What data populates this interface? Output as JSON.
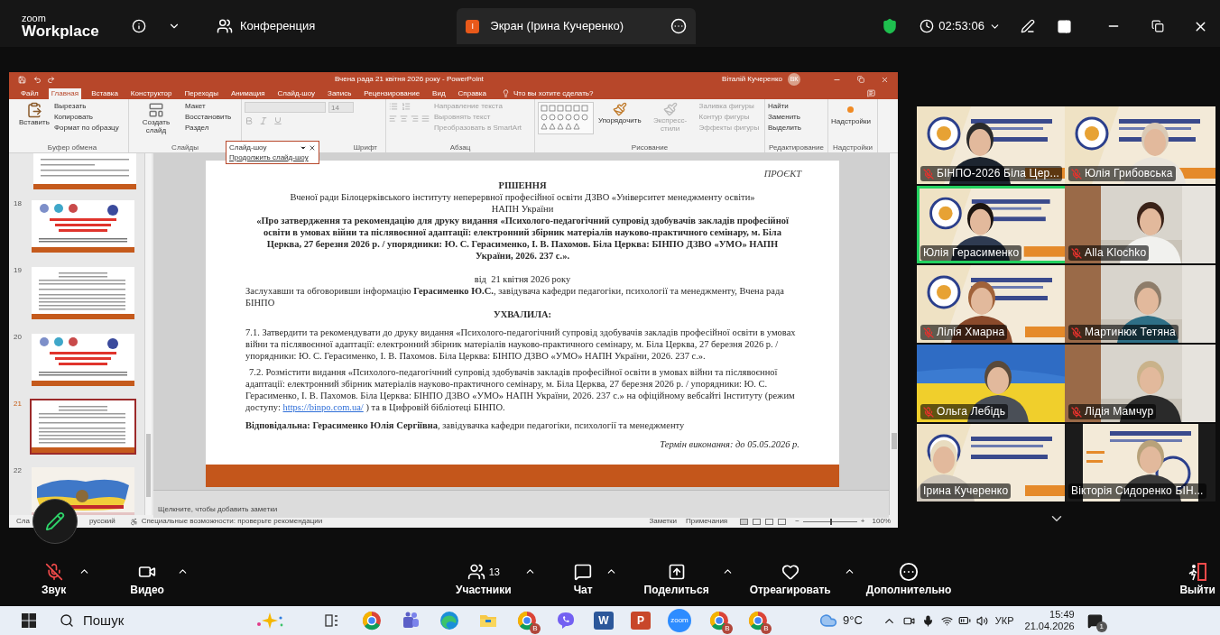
{
  "zoom_bar": {
    "logo_top": "zoom",
    "logo_bottom": "Workplace",
    "meeting_label": "Конференция",
    "share_tab": {
      "avatar": "І",
      "title": "Экран (Ірина Кучеренко)"
    },
    "timer": "02:53:06"
  },
  "powerpoint": {
    "title": "Вчена рада 21 квітня 2026 року - PowerPoint",
    "user": "Віталій Кучеренко",
    "user_initials": "ВК",
    "tabs": [
      {
        "label": "Файл",
        "selected": false
      },
      {
        "label": "Главная",
        "selected": true
      },
      {
        "label": "Вставка",
        "selected": false
      },
      {
        "label": "Конструктор",
        "selected": false
      },
      {
        "label": "Переходы",
        "selected": false
      },
      {
        "label": "Анимация",
        "selected": false
      },
      {
        "label": "Слайд-шоу",
        "selected": false
      },
      {
        "label": "Запись",
        "selected": false
      },
      {
        "label": "Рецензирование",
        "selected": false
      },
      {
        "label": "Вид",
        "selected": false
      },
      {
        "label": "Справка",
        "selected": false
      }
    ],
    "tell_me": "Что вы хотите сделать?",
    "ribbon": {
      "groups": [
        {
          "label": "Буфер обмена",
          "kind": "clipboard",
          "items": [
            {
              "label": "Вставить",
              "big": true
            },
            {
              "label": "Вырезать"
            },
            {
              "label": "Копировать"
            },
            {
              "label": "Формат по образцу"
            }
          ]
        },
        {
          "label": "Слайды",
          "kind": "slides",
          "items": [
            {
              "label": "Создать слайд",
              "big": true
            },
            {
              "label": "Макет"
            },
            {
              "label": "Восстановить"
            },
            {
              "label": "Раздел"
            }
          ]
        },
        {
          "label": "Шрифт",
          "kind": "font",
          "font_size": "14"
        },
        {
          "label": "Абзац",
          "kind": "paragraph",
          "items": [
            {
              "label": "Направление текста",
              "disabled": true
            },
            {
              "label": "Выровнять текст",
              "disabled": true
            },
            {
              "label": "Преобразовать в SmartArt",
              "disabled": true
            }
          ]
        },
        {
          "label": "Рисование",
          "kind": "drawing",
          "items": [
            {
              "label": "Упорядочить",
              "big": true
            },
            {
              "label": "Экспресс-стили",
              "big": true,
              "disabled": true
            },
            {
              "label": "Заливка фигуры",
              "disabled": true
            },
            {
              "label": "Контур фигуры",
              "disabled": true
            },
            {
              "label": "Эффекты фигуры",
              "disabled": true
            }
          ]
        },
        {
          "label": "Редактирование",
          "kind": "editing",
          "items": [
            {
              "label": "Найти"
            },
            {
              "label": "Заменить"
            },
            {
              "label": "Выделить"
            }
          ]
        },
        {
          "label": "Надстройки",
          "kind": "addins",
          "items": [
            {
              "label": "Надстройки",
              "big": true
            }
          ]
        }
      ]
    },
    "slideshow_popup": {
      "title": "Слайд-шоу",
      "action": "Продолжить слайд-шоу"
    },
    "thumbnails": [
      {
        "number": "18",
        "kind": "title",
        "selected": false
      },
      {
        "number": "19",
        "kind": "text",
        "selected": false
      },
      {
        "number": "20",
        "kind": "title",
        "selected": false
      },
      {
        "number": "21",
        "kind": "text",
        "selected": true
      },
      {
        "number": "22",
        "kind": "map",
        "selected": false
      }
    ],
    "slide": {
      "draft_mark": "ПРОЄКТ",
      "heading": "РІШЕННЯ",
      "subheading": "Вченої ради Білоцерківського інституту неперервної професійної освіти ДЗВО «Університет менеджменту освіти»",
      "subheading_2": "НАПН України",
      "topic": "«Про затвердження та рекомендацію для друку видання «Психолого-педагогічний супровід здобувачів закладів професійної освіти в умовах війни та післявоєнної адаптації: електронний збірник матеріалів науково-практичного семінару, м. Біла Церква, 27 березня 2026 р. / упорядники: Ю. С. Герасименко, І. В. Пахомов. Біла Церква: БІНПО ДЗВО «УМО» НАПН України, 2026. 237 с.».",
      "date": "від  21 квітня 2026 року",
      "intro": "Заслухавши та обговоривши інформацію **Герасименко Ю.С.**, завідувача кафедри педагогіки, психології та менеджменту, Вчена рада БІНПО",
      "resolved": "УХВАЛИЛА:",
      "item_1": "7.1. Затвердити та рекомендувати до друку видання «Психолого-педагогічний супровід здобувачів закладів професійної освіти в умовах війни та післявоєнної адаптації: електронний збірник матеріалів науково-практичного семінару, м. Біла Церква, 27 березня 2026 р. / упорядники: Ю. С. Герасименко, І. В. Пахомов. Біла Церква: БІНПО ДЗВО «УМО» НАПН України, 2026. 237 с.».",
      "item_2": {
        "before": "7.2. Розмістити видання «Психолого-педагогічний супровід здобувачів закладів професійної освіти в умовах війни та післявоєнної адаптації: електронний збірник матеріалів науково-практичного семінару, м. Біла Церква, 27 березня 2026 р. / упорядники: Ю. С. Герасименко, І. В. Пахомов. Біла Церква: БІНПО ДЗВО «УМО» НАПН України, 2026. 237 с.» на офіційному вебсайті Інституту (режим доступу: ",
        "link": "https://binpo.com.ua/",
        "after": " ) та в Цифровій бібліотеці БІНПО."
      },
      "responsible": "**Відповідальна: Герасименко Юлія Сергіївна**, завідувачка кафедри педагогіки, психології та менеджменту",
      "deadline": "Термін виконання: до 05.05.2026 р."
    },
    "notes_placeholder": "Щелкните, чтобы добавить заметки",
    "status": {
      "slide_info": "Сла",
      "language": "русский",
      "accessibility": "Специальные возможности: проверьте рекомендации",
      "notes": "Заметки",
      "comments": "Примечания",
      "zoom_out": "−",
      "zoom_in": "+",
      "zoom_slider": {
        "level": 0.5
      },
      "zoom_value": "100%"
    }
  },
  "participants": [
    {
      "name": "БІНПО-2026 Біла Цер...",
      "muted": true,
      "speaking": false,
      "kind": "banner"
    },
    {
      "name": "Юлія Грибовська",
      "muted": true,
      "speaking": false,
      "kind": "banner"
    },
    {
      "name": "Юлія Герасименко",
      "muted": false,
      "speaking": true,
      "kind": "banner"
    },
    {
      "name": "Alla Klochko",
      "muted": true,
      "speaking": false,
      "kind": "room"
    },
    {
      "name": "Лілія Хмарна",
      "muted": true,
      "speaking": false,
      "kind": "banner"
    },
    {
      "name": "Мартинюк Тетяна",
      "muted": true,
      "speaking": false,
      "kind": "room"
    },
    {
      "name": "Ольга Лебідь",
      "muted": true,
      "speaking": false,
      "kind": "flag"
    },
    {
      "name": "Лідія Мамчур",
      "muted": true,
      "speaking": false,
      "kind": "room"
    },
    {
      "name": "Ірина Кучеренко",
      "muted": false,
      "speaking": false,
      "kind": "banner"
    },
    {
      "name": "Вікторія Сидоренко БІН...",
      "muted": false,
      "speaking": false,
      "kind": "screen"
    }
  ],
  "toolbar": [
    {
      "kind": "audio",
      "label": "Звук",
      "muted": true,
      "menu": true
    },
    {
      "kind": "video",
      "label": "Видео",
      "menu": true
    },
    {
      "kind": "participants",
      "label": "Участники",
      "count": "13",
      "menu": true
    },
    {
      "kind": "chat",
      "label": "Чат",
      "menu": true
    },
    {
      "kind": "share",
      "label": "Поделиться",
      "menu": true
    },
    {
      "kind": "react",
      "label": "Отреагировать",
      "menu": true
    },
    {
      "kind": "more",
      "label": "Дополнительно"
    },
    {
      "kind": "leave",
      "label": "Выйти"
    }
  ],
  "taskbar": {
    "search": "Пошук",
    "apps": [
      {
        "kind": "browser"
      },
      {
        "kind": "teams"
      },
      {
        "kind": "edge"
      },
      {
        "kind": "folder"
      },
      {
        "kind": "browser",
        "badge": "B"
      },
      {
        "kind": "viber"
      },
      {
        "kind": "word",
        "label": "W"
      },
      {
        "kind": "powerpoint",
        "label": "P"
      },
      {
        "kind": "zoom",
        "label": "zoom"
      },
      {
        "kind": "browser",
        "badge": "B"
      },
      {
        "kind": "browser",
        "badge": "B"
      }
    ],
    "temperature": "9°C",
    "language": "УКР",
    "time": "15:49",
    "date": "21.04.2026",
    "notifications": "1"
  }
}
